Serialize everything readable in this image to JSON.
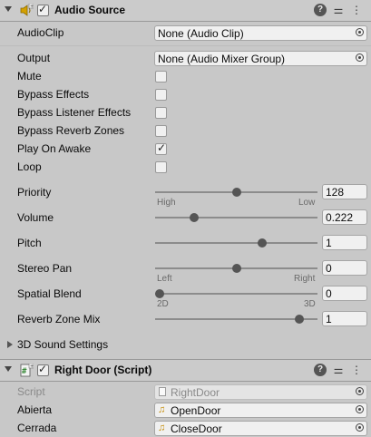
{
  "audio_source": {
    "title": "Audio Source",
    "enabled": true,
    "audio_clip": {
      "label": "AudioClip",
      "value": "None (Audio Clip)"
    },
    "output": {
      "label": "Output",
      "value": "None (Audio Mixer Group)"
    },
    "toggles": [
      {
        "label": "Mute",
        "checked": false
      },
      {
        "label": "Bypass Effects",
        "checked": false
      },
      {
        "label": "Bypass Listener Effects",
        "checked": false
      },
      {
        "label": "Bypass Reverb Zones",
        "checked": false
      },
      {
        "label": "Play On Awake",
        "checked": true
      },
      {
        "label": "Loop",
        "checked": false
      }
    ],
    "sliders": [
      {
        "label": "Priority",
        "value": "128",
        "fraction": 0.5,
        "min_label": "High",
        "max_label": "Low"
      },
      {
        "label": "Volume",
        "value": "0.222",
        "fraction": 0.222
      },
      {
        "label": "Pitch",
        "value": "1",
        "fraction": 0.667
      },
      {
        "label": "Stereo Pan",
        "value": "0",
        "fraction": 0.5,
        "min_label": "Left",
        "max_label": "Right"
      },
      {
        "label": "Spatial Blend",
        "value": "0",
        "fraction": 0.0,
        "min_label": "2D",
        "max_label": "3D"
      },
      {
        "label": "Reverb Zone Mix",
        "value": "1",
        "fraction": 0.909
      }
    ],
    "sound_settings_label": "3D Sound Settings"
  },
  "right_door_script": {
    "title": "Right Door (Script)",
    "enabled": true,
    "script": {
      "label": "Script",
      "value": "RightDoor"
    },
    "abierta": {
      "label": "Abierta",
      "value": "OpenDoor"
    },
    "cerrada": {
      "label": "Cerrada",
      "value": "CloseDoor"
    }
  },
  "icons": {
    "audio_source": "speaker-icon",
    "script": "script-icon",
    "help": "help-icon",
    "presets": "presets-icon",
    "menu": "kebab-menu-icon",
    "object_picker": "object-picker-icon",
    "audio_clip_asset": "music-note-icon"
  },
  "colors": {
    "panel_bg": "#c8c8c8",
    "field_bg": "#f0f0f0",
    "slider_thumb": "#555555",
    "audio_icon": "#d4a100"
  }
}
